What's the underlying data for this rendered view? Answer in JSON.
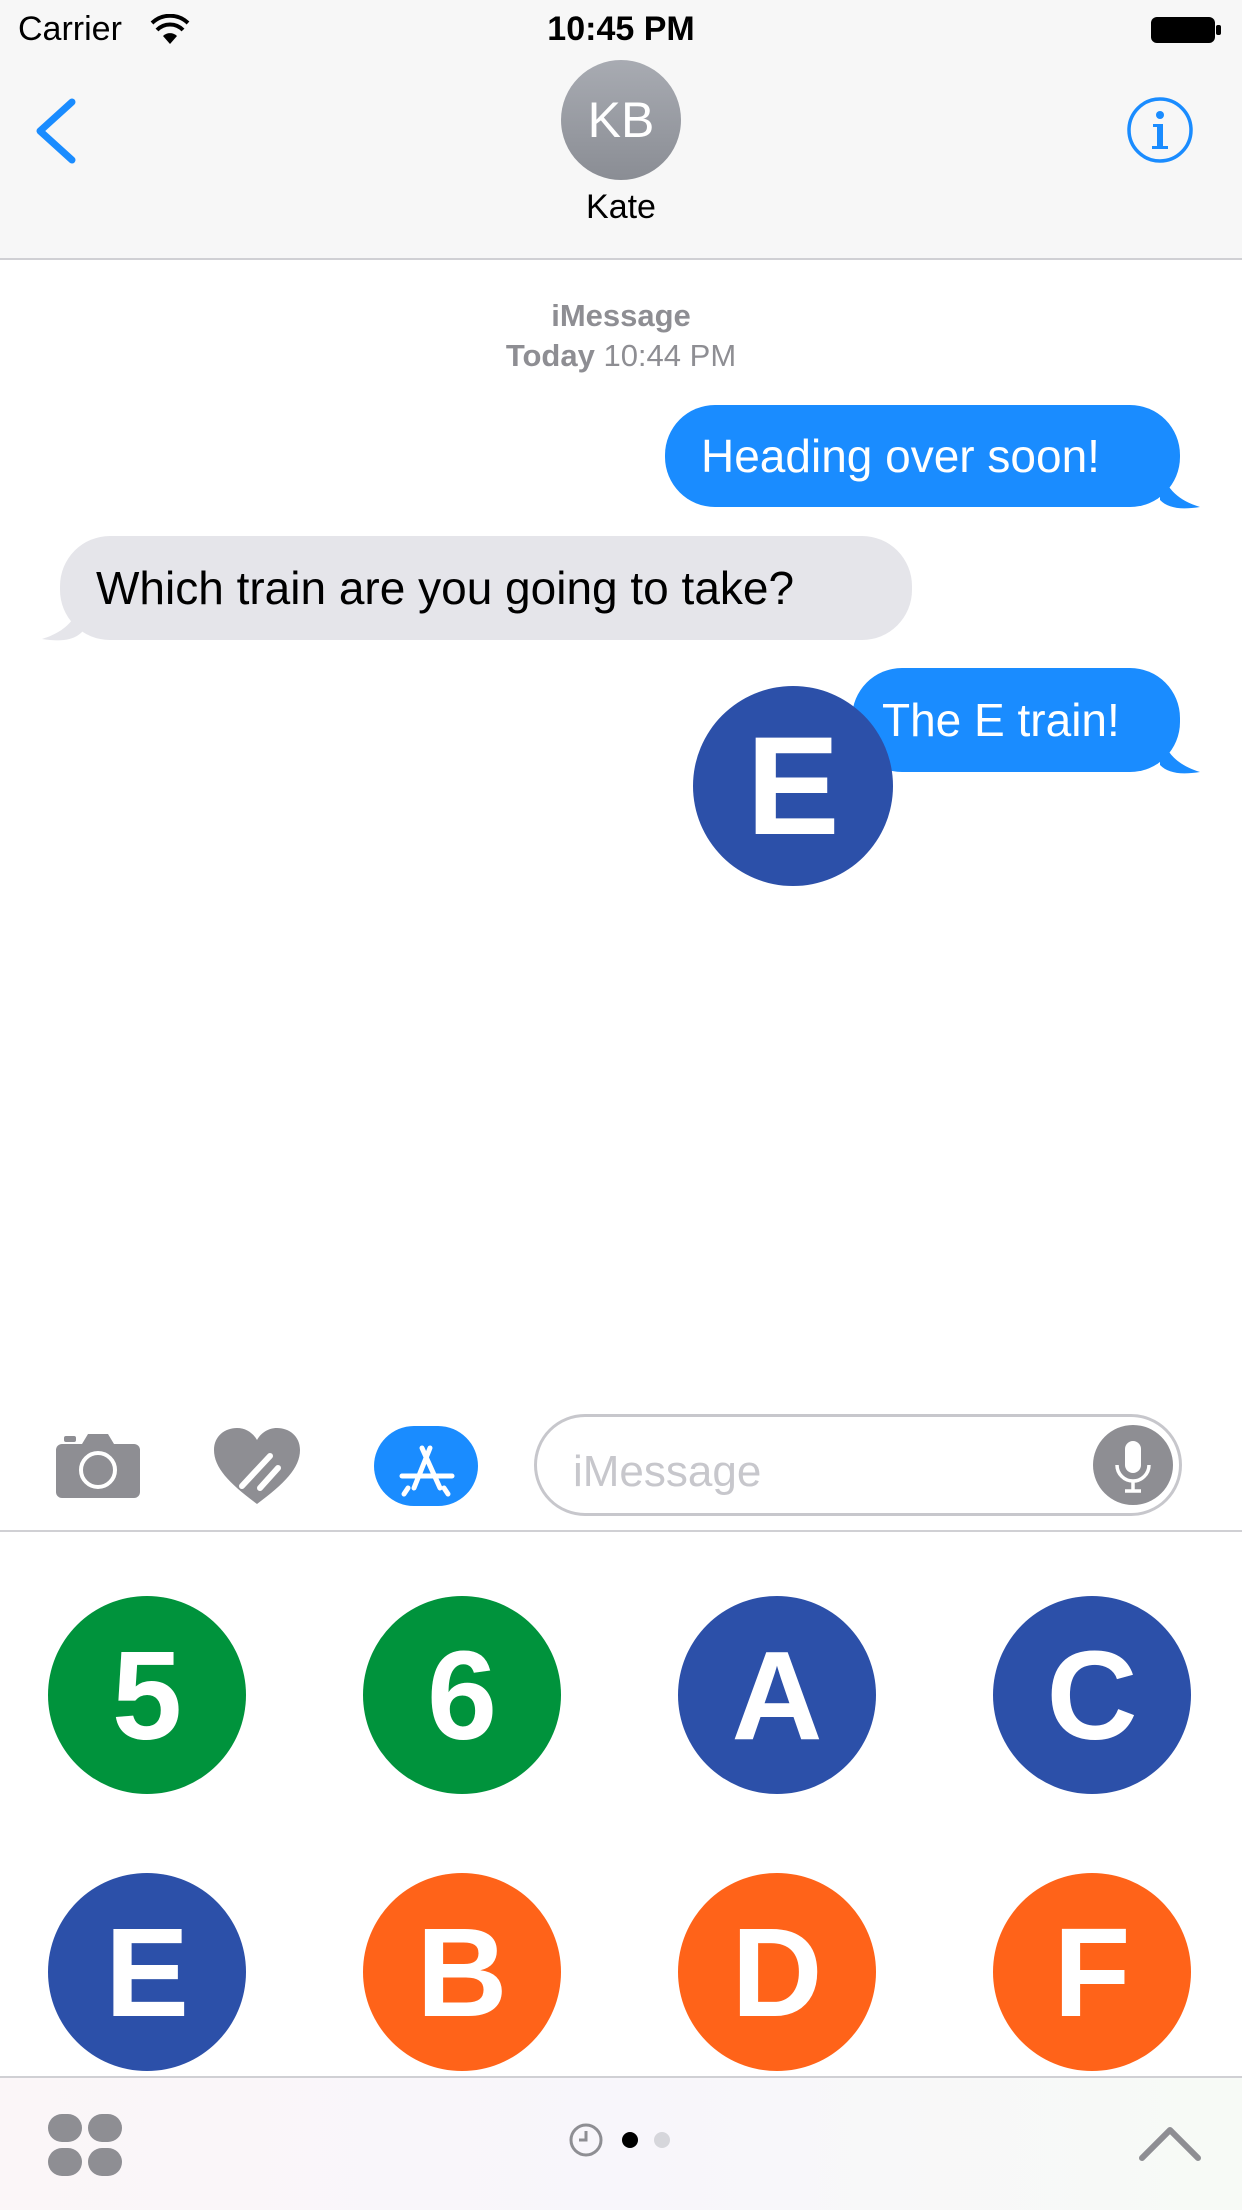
{
  "status_bar": {
    "carrier": "Carrier",
    "time": "10:45 PM"
  },
  "nav": {
    "avatar_initials": "KB",
    "contact_name": "Kate"
  },
  "conversation": {
    "service": "iMessage",
    "timestamp_day": "Today",
    "timestamp_time": "10:44 PM",
    "messages": [
      {
        "direction": "outgoing",
        "text": "Heading over soon!"
      },
      {
        "direction": "incoming",
        "text": "Which train are you going to take?"
      },
      {
        "direction": "outgoing",
        "text": "The E train!"
      }
    ],
    "placed_sticker": {
      "letter": "E",
      "color": "#2c50a9"
    }
  },
  "input_bar": {
    "placeholder": "iMessage"
  },
  "sticker_drawer": {
    "stickers": [
      {
        "label": "5",
        "color": "#00933c"
      },
      {
        "label": "6",
        "color": "#00933c"
      },
      {
        "label": "A",
        "color": "#2c50a9"
      },
      {
        "label": "C",
        "color": "#2c50a9"
      },
      {
        "label": "E",
        "color": "#2c50a9"
      },
      {
        "label": "B",
        "color": "#ff6319"
      },
      {
        "label": "D",
        "color": "#ff6319"
      },
      {
        "label": "F",
        "color": "#ff6319"
      }
    ],
    "page_indicator": {
      "pages": 2,
      "current": 1
    }
  },
  "colors": {
    "accent": "#1a8cff",
    "incoming_bubble": "#e5e5ea",
    "secondary_text": "#8e8e93"
  }
}
